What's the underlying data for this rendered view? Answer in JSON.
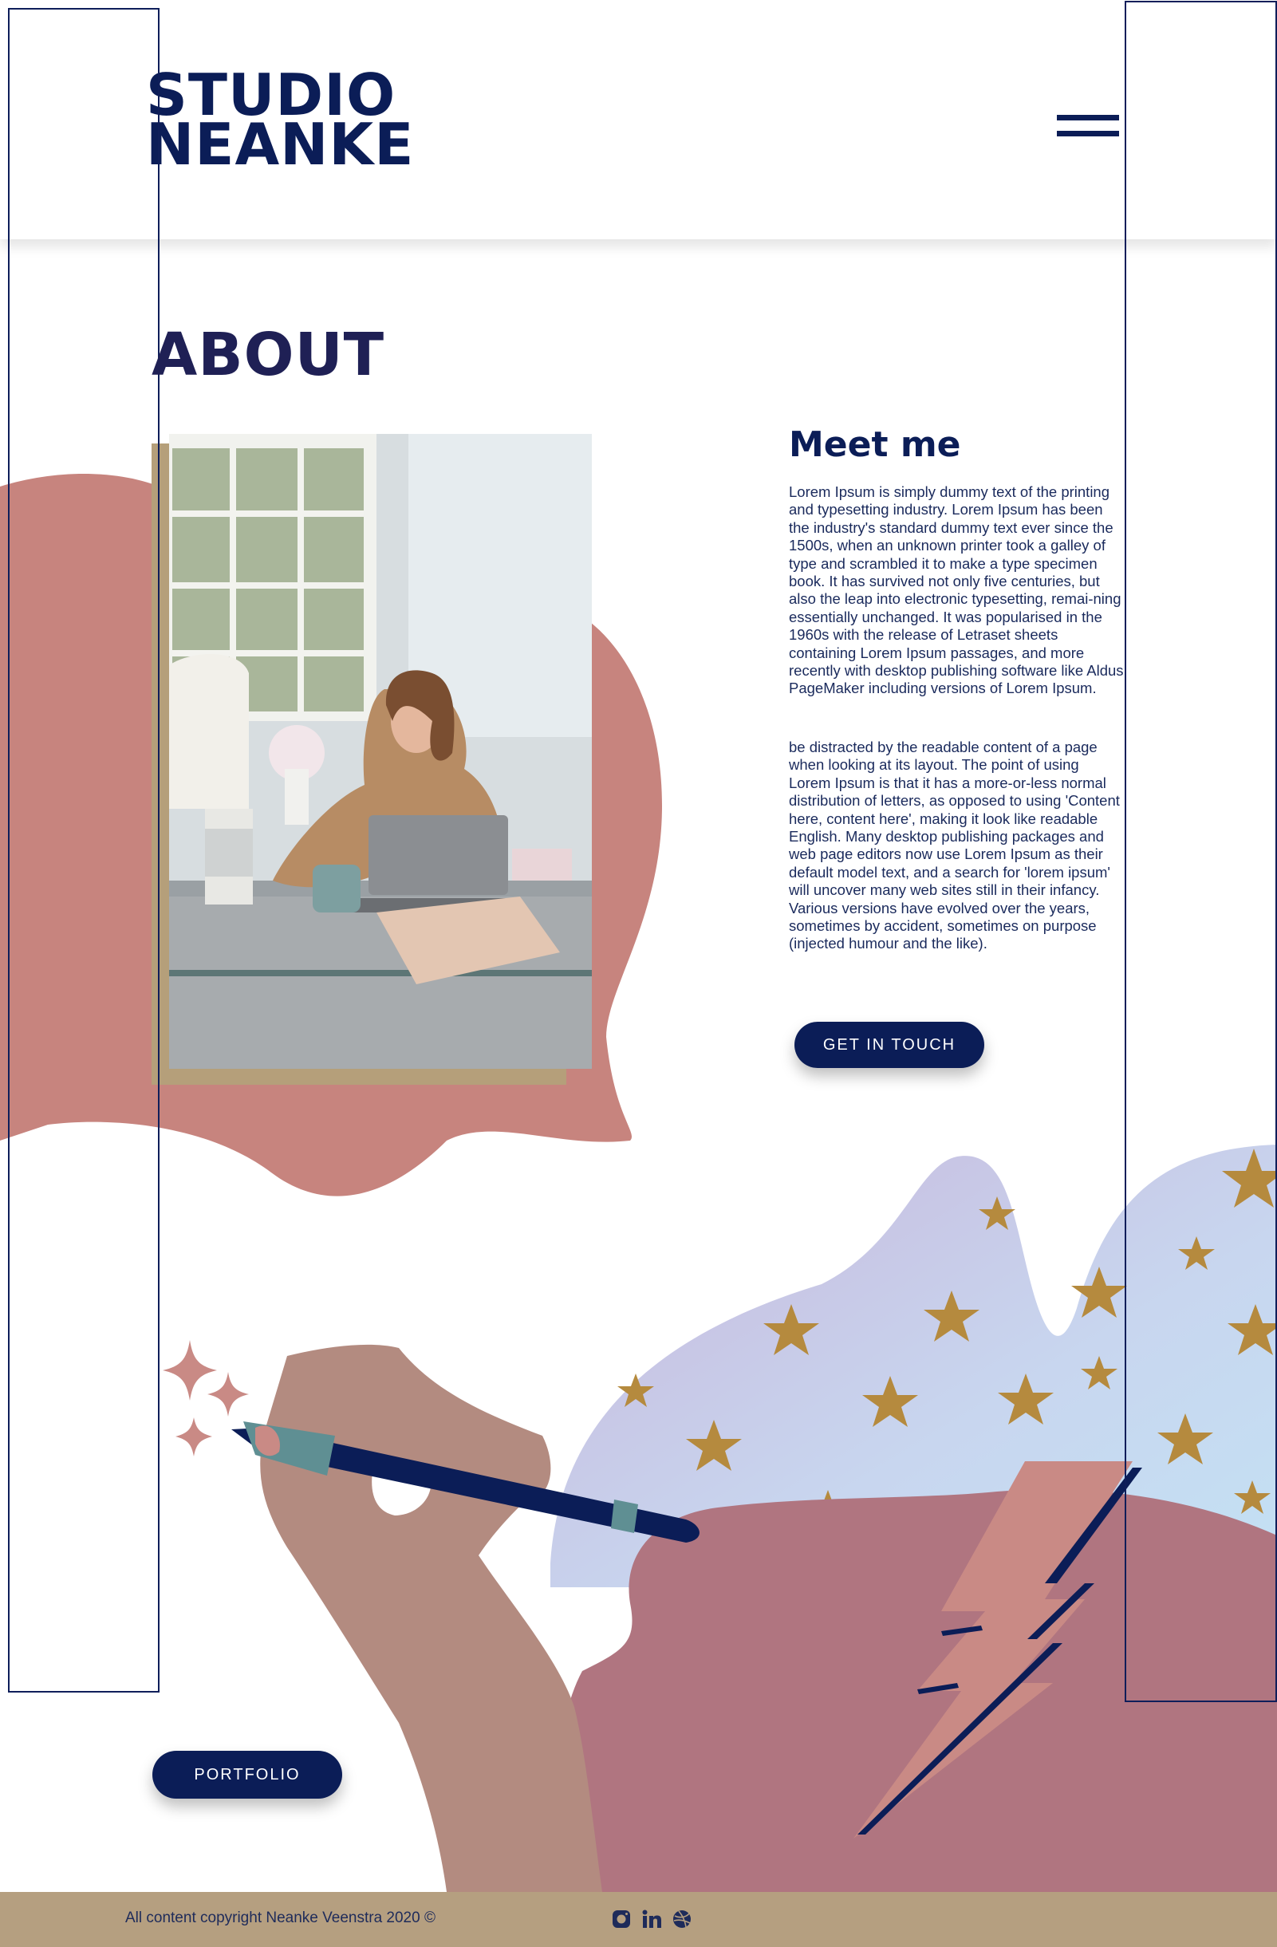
{
  "header": {
    "logo_line1": "STUDIO",
    "logo_line2": "NEANKE"
  },
  "about": {
    "title": "ABOUT",
    "meet_title": "Meet me",
    "paragraph1": "Lorem Ipsum is simply dummy text of the printing and typesetting industry. Lorem Ipsum has been the industry's standard dummy text ever since the 1500s, when an unknown printer took a galley of type and scrambled it to make a type specimen book. It has survived not only five centuries, but also the leap into electronic typesetting, remai-ning essentially unchanged. It was popularised in the 1960s with the release of Letraset sheets containing Lorem Ipsum passages, and more recently with desktop publishing software like Aldus PageMaker including versions of Lorem Ipsum.",
    "paragraph2": "be distracted by the readable content of a page when looking at its layout. The point of using Lorem Ipsum is that it has a more-or-less normal distribution of letters, as opposed to using 'Content here, content here', making it look like readable English. Many desktop publishing packages and web page editors now use Lorem Ipsum as their default model text, and a search for 'lorem ipsum' will uncover many web sites still in their infancy. Various versions have evolved over the years, sometimes by accident, sometimes on purpose (injected humour and the like).",
    "cta_label": "GET IN TOUCH"
  },
  "portfolio": {
    "label": "PORTFOLIO"
  },
  "footer": {
    "copyright": "All content copyright Neanke Veenstra 2020 ©",
    "socials": [
      "instagram-icon",
      "linkedin-icon",
      "dribbble-icon"
    ]
  },
  "colors": {
    "navy": "#0b1d57",
    "blob_pink": "#c7847e",
    "mauve": "#b07580",
    "gold": "#b59f7a",
    "star_gold": "#b58a3e"
  }
}
